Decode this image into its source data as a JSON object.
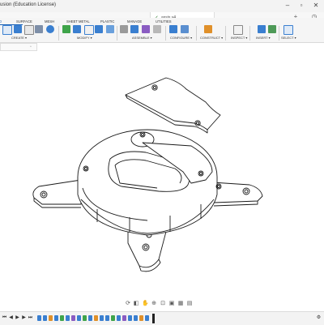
{
  "window": {
    "title": "usion (Education License)",
    "controls": [
      "minimize-icon",
      "maximize-icon",
      "close-icon"
    ]
  },
  "document_tab": {
    "name": "assis v4",
    "saved_icon": "check-icon"
  },
  "workspace_tabs": [
    {
      "label": "D",
      "active": true
    },
    {
      "label": "SURFACE",
      "active": false
    },
    {
      "label": "MESH",
      "active": false
    },
    {
      "label": "SHEET METAL",
      "active": false
    },
    {
      "label": "PLASTIC",
      "active": false
    },
    {
      "label": "MANAGE",
      "active": false
    },
    {
      "label": "UTILITIES",
      "active": false
    }
  ],
  "tool_groups": [
    {
      "label": "CREATE ▾"
    },
    {
      "label": "MODIFY ▾"
    },
    {
      "label": "ASSEMBLE ▾"
    },
    {
      "label": "CONFIGURE ▾"
    },
    {
      "label": "CONSTRUCT ▾"
    },
    {
      "label": "INSPECT ▾"
    },
    {
      "label": "INSERT ▾"
    },
    {
      "label": "SELECT ▾"
    }
  ],
  "colors": {
    "accent": "#1d63b8",
    "tool_blue": "#3a7fd0",
    "tool_green": "#3fa44a",
    "tool_orange": "#e0902a",
    "tool_purple": "#8a5cc2"
  },
  "timeline": {
    "marker_icon": "timeline-marker-icon"
  }
}
